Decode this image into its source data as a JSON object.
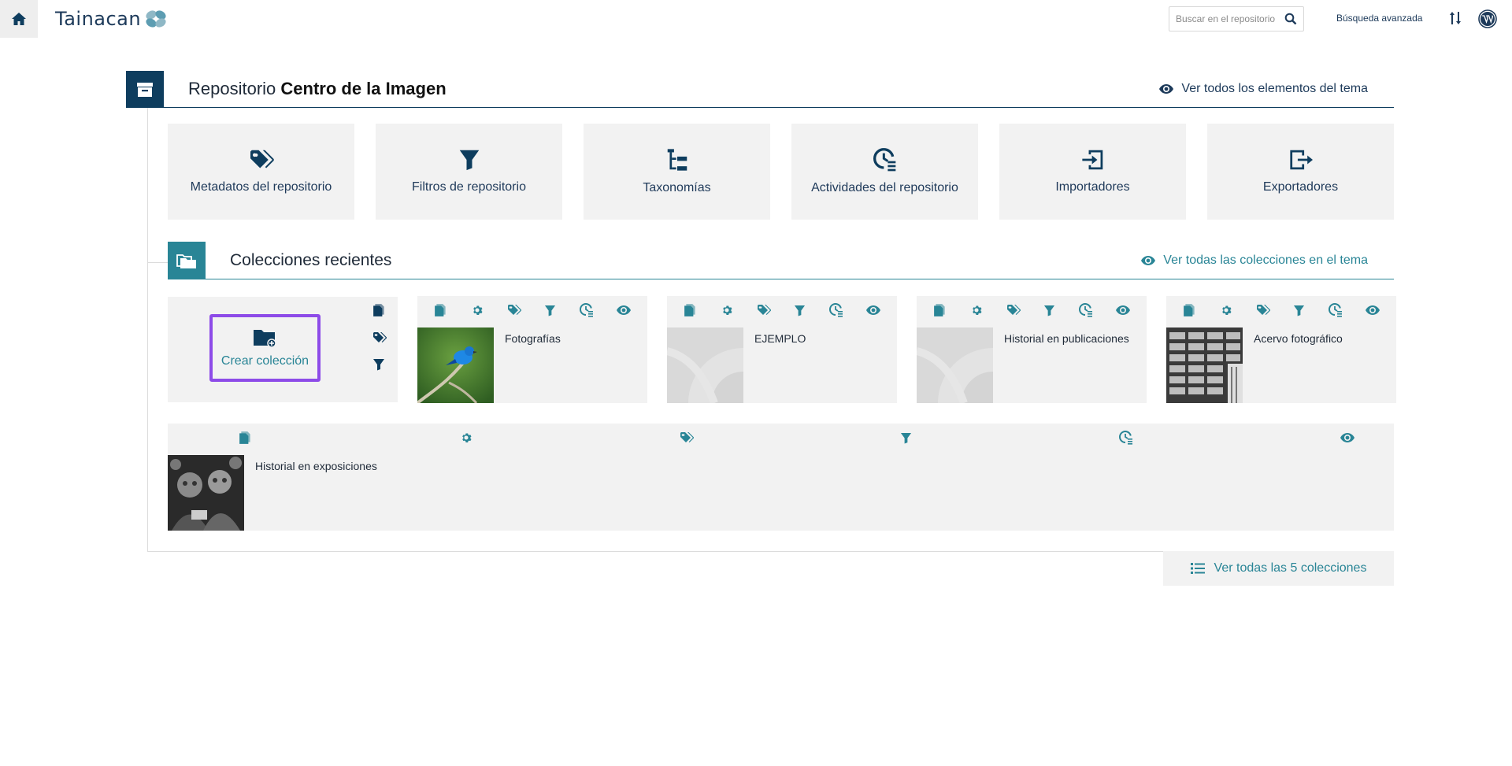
{
  "topbar": {
    "logo_text": "Tainacan",
    "search_placeholder": "Buscar en el repositorio",
    "advanced_search": "Búsqueda avanzada"
  },
  "repository": {
    "title_prefix": "Repositorio ",
    "title_name": "Centro de la Imagen",
    "see_all_theme": "Ver todos los elementos del tema"
  },
  "tiles": [
    {
      "label": "Metadatos del repositorio",
      "icon": "tags-icon"
    },
    {
      "label": "Filtros de repositorio",
      "icon": "filter-icon"
    },
    {
      "label": "Taxonomías",
      "icon": "taxonomy-icon"
    },
    {
      "label": "Actividades del repositorio",
      "icon": "activities-icon"
    },
    {
      "label": "Importadores",
      "icon": "importer-icon"
    },
    {
      "label": "Exportadores",
      "icon": "exporter-icon"
    }
  ],
  "recent": {
    "title": "Colecciones recientes",
    "see_all_theme": "Ver todas las colecciones en el tema",
    "create_label": "Crear colección",
    "view_all": "Ver todas las 5 colecciones"
  },
  "collections": [
    {
      "name": "Fotografías",
      "thumb": "bird"
    },
    {
      "name": "EJEMPLO",
      "thumb": "placeholder"
    },
    {
      "name": "Historial en publicaciones",
      "thumb": "placeholder"
    },
    {
      "name": "Acervo fotográfico",
      "thumb": "archive"
    },
    {
      "name": "Historial en exposiciones",
      "thumb": "people"
    }
  ],
  "colors": {
    "navy": "#0e3d5e",
    "teal": "#298596",
    "highlight": "#8d4be8",
    "card_bg": "#f2f2f2"
  }
}
